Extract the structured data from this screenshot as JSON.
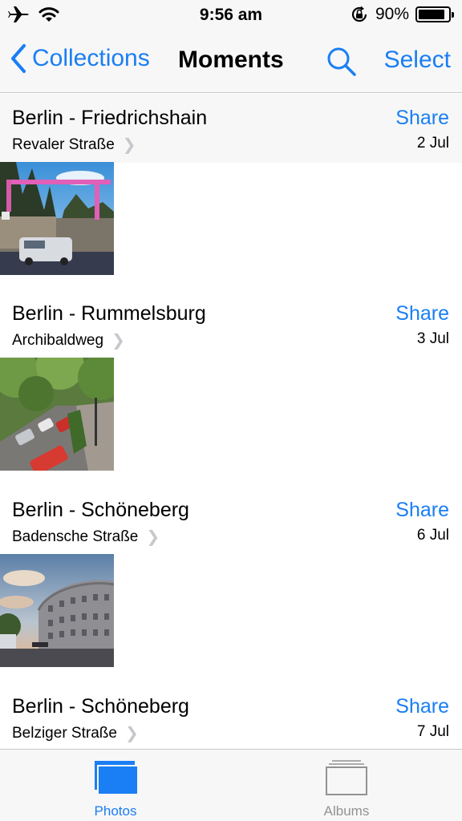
{
  "status": {
    "time": "9:56 am",
    "battery": "90%",
    "battery_level": 0.9
  },
  "nav": {
    "back_label": "Collections",
    "title": "Moments",
    "select_label": "Select"
  },
  "moments": [
    {
      "title": "Berlin - Friedrichshain",
      "location": "Revaler Straße",
      "date": "2 Jul",
      "share": "Share"
    },
    {
      "title": "Berlin - Rummelsburg",
      "location": "Archibaldweg",
      "date": "3 Jul",
      "share": "Share"
    },
    {
      "title": "Berlin - Schöneberg",
      "location": "Badensche Straße",
      "date": "6 Jul",
      "share": "Share"
    },
    {
      "title": "Berlin - Schöneberg",
      "location": "Belziger Straße",
      "date": "7 Jul",
      "share": "Share"
    }
  ],
  "tabs": [
    {
      "label": "Photos",
      "active": true
    },
    {
      "label": "Albums",
      "active": false
    }
  ],
  "colors": {
    "accent": "#1a7ef4",
    "inactive": "#929292"
  }
}
